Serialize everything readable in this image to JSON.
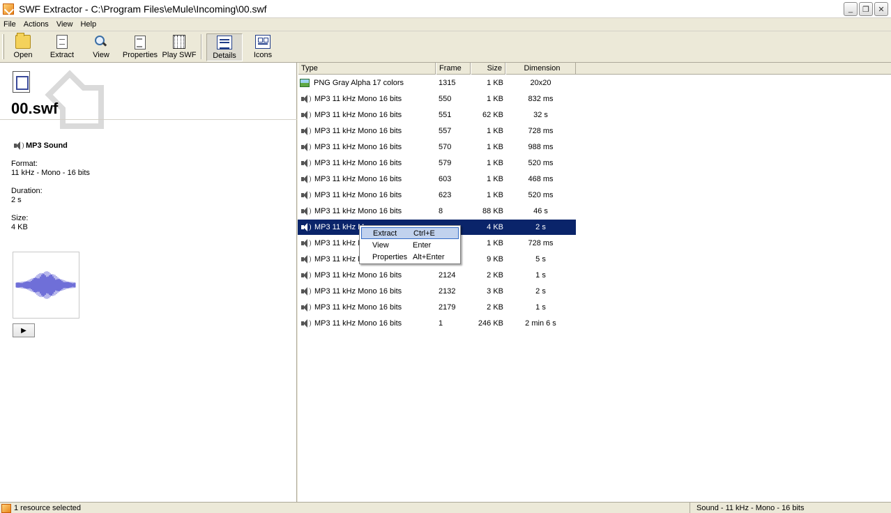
{
  "window": {
    "title": "SWF Extractor - C:\\Program Files\\eMule\\Incoming\\00.swf"
  },
  "menu": [
    "File",
    "Actions",
    "View",
    "Help"
  ],
  "toolbar": [
    {
      "label": "Open",
      "icon": "folder-open-icon"
    },
    {
      "label": "Extract",
      "icon": "extract-icon"
    },
    {
      "label": "View",
      "icon": "magnifier-icon"
    },
    {
      "label": "Properties",
      "icon": "properties-icon"
    },
    {
      "label": "Play SWF",
      "icon": "film-icon"
    },
    {
      "label": "Details",
      "icon": "details-view-icon",
      "pressed": true
    },
    {
      "label": "Icons",
      "icon": "icons-view-icon"
    }
  ],
  "preview": {
    "file_name": "00.swf",
    "resource_type": "MP3 Sound",
    "format_label": "Format:",
    "format_value": "11 kHz - Mono - 16 bits",
    "duration_label": "Duration:",
    "duration_value": "2 s",
    "size_label": "Size:",
    "size_value": "4 KB"
  },
  "list": {
    "columns": [
      "Type",
      "Frame",
      "Size",
      "Dimension"
    ],
    "rows": [
      {
        "type": "PNG Gray Alpha 17 colors",
        "frame": "1315",
        "size": "1 KB",
        "dim": "20x20",
        "icon": "image-icon"
      },
      {
        "type": "MP3 11 kHz Mono 16 bits",
        "frame": "550",
        "size": "1 KB",
        "dim": "832 ms",
        "icon": "speaker-icon"
      },
      {
        "type": "MP3 11 kHz Mono 16 bits",
        "frame": "551",
        "size": "62 KB",
        "dim": "32 s",
        "icon": "speaker-icon"
      },
      {
        "type": "MP3 11 kHz Mono 16 bits",
        "frame": "557",
        "size": "1 KB",
        "dim": "728 ms",
        "icon": "speaker-icon"
      },
      {
        "type": "MP3 11 kHz Mono 16 bits",
        "frame": "570",
        "size": "1 KB",
        "dim": "988 ms",
        "icon": "speaker-icon"
      },
      {
        "type": "MP3 11 kHz Mono 16 bits",
        "frame": "579",
        "size": "1 KB",
        "dim": "520 ms",
        "icon": "speaker-icon"
      },
      {
        "type": "MP3 11 kHz Mono 16 bits",
        "frame": "603",
        "size": "1 KB",
        "dim": "468 ms",
        "icon": "speaker-icon"
      },
      {
        "type": "MP3 11 kHz Mono 16 bits",
        "frame": "623",
        "size": "1 KB",
        "dim": "520 ms",
        "icon": "speaker-icon"
      },
      {
        "type": "MP3 11 kHz Mono 16 bits",
        "frame": "8",
        "size": "88 KB",
        "dim": "46 s",
        "icon": "speaker-icon"
      },
      {
        "type": "MP3 11 kHz Mo",
        "frame": "",
        "size": "4 KB",
        "dim": "2 s",
        "icon": "speaker-icon",
        "selected": true
      },
      {
        "type": "MP3 11 kHz M",
        "frame": "",
        "size": "1 KB",
        "dim": "728 ms",
        "icon": "speaker-icon"
      },
      {
        "type": "MP3 11 kHz M",
        "frame": "",
        "size": "9 KB",
        "dim": "5 s",
        "icon": "speaker-icon"
      },
      {
        "type": "MP3 11 kHz Mono 16 bits",
        "frame": "2124",
        "size": "2 KB",
        "dim": "1 s",
        "icon": "speaker-icon"
      },
      {
        "type": "MP3 11 kHz Mono 16 bits",
        "frame": "2132",
        "size": "3 KB",
        "dim": "2 s",
        "icon": "speaker-icon"
      },
      {
        "type": "MP3 11 kHz Mono 16 bits",
        "frame": "2179",
        "size": "2 KB",
        "dim": "1 s",
        "icon": "speaker-icon"
      },
      {
        "type": "MP3 11 kHz Mono 16 bits",
        "frame": "1",
        "size": "246 KB",
        "dim": "2 min 6 s",
        "icon": "speaker-icon"
      }
    ]
  },
  "context_menu": [
    {
      "label": "Extract",
      "shortcut": "Ctrl+E",
      "highlighted": true
    },
    {
      "label": "View",
      "shortcut": "Enter"
    },
    {
      "label": "Properties",
      "shortcut": "Alt+Enter"
    }
  ],
  "status": {
    "left": "1 resource selected",
    "right": "Sound - 11 kHz - Mono - 16 bits"
  }
}
